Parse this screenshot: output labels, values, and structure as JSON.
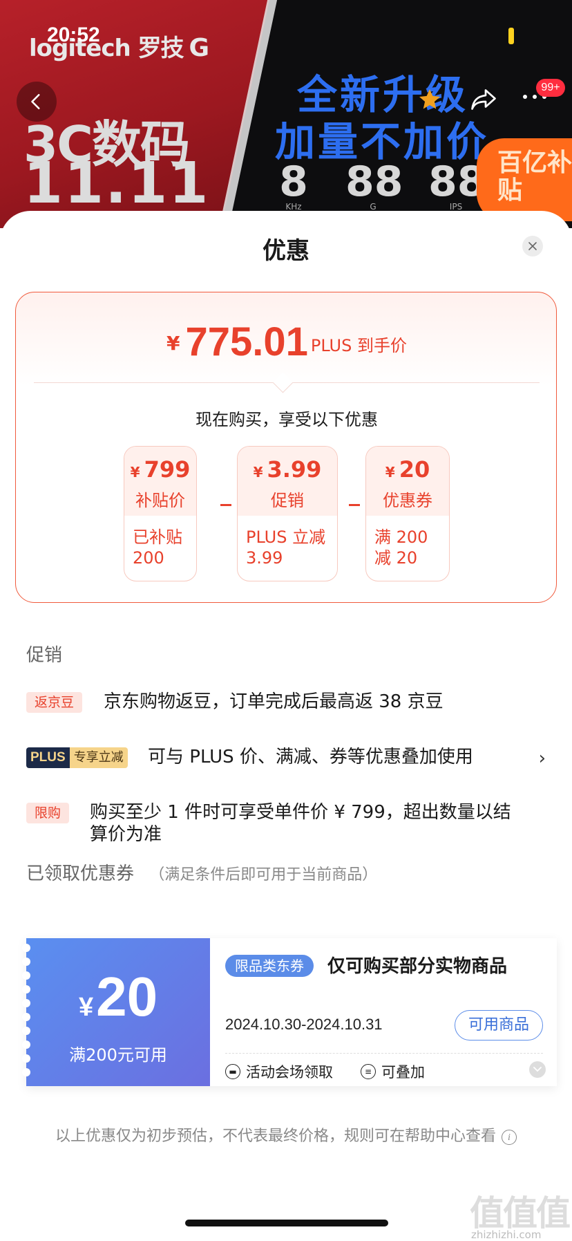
{
  "status": {
    "time": "20:52"
  },
  "banner": {
    "brand": "logitech 罗技",
    "brand_g": "G",
    "category": "3C数码",
    "date": "11.11",
    "headline1": "全新升级",
    "headline2": "加量不加价",
    "specs": [
      {
        "value": "8",
        "unit": "KHz"
      },
      {
        "value": "88",
        "unit": "G"
      },
      {
        "value": "88",
        "unit": "IPS"
      }
    ],
    "subsidy_badge": "百亿补贴",
    "message_count": "99+"
  },
  "sheet": {
    "title": "优惠",
    "price": {
      "currency": "¥",
      "amount": "775.01",
      "label": "PLUS 到手价",
      "enjoy_text": "现在购买，享受以下优惠"
    },
    "discounts": [
      {
        "currency": "¥",
        "amount": "799",
        "label": "补贴价",
        "line1": "已补贴",
        "line2": "200"
      },
      {
        "currency": "¥",
        "amount": "3.99",
        "label": "促销",
        "line1": "PLUS 立减",
        "line2": "3.99"
      },
      {
        "currency": "¥",
        "amount": "20",
        "label": "优惠券",
        "line1": "满 200",
        "line2": "减 20"
      }
    ],
    "promotions": {
      "title": "促销",
      "items": [
        {
          "tag": "返京豆",
          "text": "京东购物返豆，订单完成后最高返 38 京豆"
        },
        {
          "tag_a": "PLUS",
          "tag_b": "专享立减",
          "text": "可与 PLUS 价、满减、券等优惠叠加使用",
          "chevron": "›"
        },
        {
          "tag": "限购",
          "text": "购买至少 1 件时可享受单件价 ¥ 799，超出数量以结算价为准"
        }
      ]
    },
    "coupons": {
      "title": "已领取优惠券",
      "subtitle": "（满足条件后即可用于当前商品）",
      "items": [
        {
          "currency": "¥",
          "amount": "20",
          "condition": "满200元可用",
          "type": "限品类东券",
          "desc": "仅可购买部分实物商品",
          "date": "2024.10.30-2024.10.31",
          "button": "可用商品",
          "feature1": "活动会场领取",
          "feature2": "可叠加"
        }
      ]
    },
    "disclaimer": "以上优惠仅为初步预估，不代表最终价格，规则可在帮助中心查看"
  },
  "watermark": {
    "main": "值值值",
    "sub": "zhizhizhi.com"
  },
  "colors": {
    "accent": "#e8412c",
    "coupon_blue": "#5b8ce8",
    "plus_navy": "#1c2a48",
    "plus_gold": "#f6d48a"
  }
}
